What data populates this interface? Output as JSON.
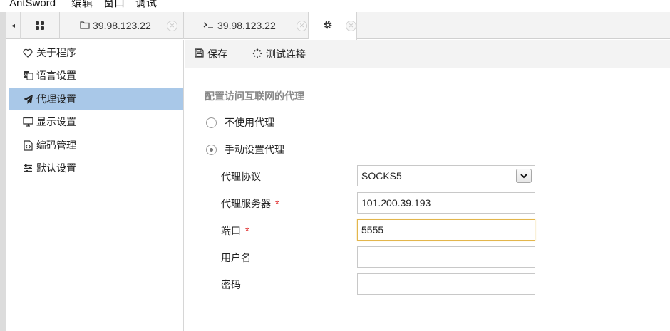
{
  "menubar": {
    "items": [
      "AntSword",
      "编辑",
      "窗口",
      "调试"
    ]
  },
  "tabs": {
    "scroll_left": "◂",
    "home_icon": "grid-icon",
    "items": [
      {
        "label": "39.98.123.22",
        "icon": "folder-icon",
        "close": "✕"
      },
      {
        "label": "39.98.123.22",
        "icon": "terminal-icon",
        "close": "✕"
      },
      {
        "label": "",
        "icon": "gear-icon",
        "close": "✕"
      }
    ]
  },
  "sidebar": {
    "items": [
      {
        "label": "关于程序",
        "icon": "heart-icon"
      },
      {
        "label": "语言设置",
        "icon": "language-icon"
      },
      {
        "label": "代理设置",
        "icon": "paper-plane-icon",
        "active": true
      },
      {
        "label": "显示设置",
        "icon": "monitor-icon"
      },
      {
        "label": "编码管理",
        "icon": "code-file-icon"
      },
      {
        "label": "默认设置",
        "icon": "sliders-icon"
      }
    ]
  },
  "toolbar": {
    "save_label": "保存",
    "test_label": "测试连接"
  },
  "form": {
    "title": "配置访问互联网的代理",
    "no_proxy_label": "不使用代理",
    "manual_proxy_label": "手动设置代理",
    "selected_mode": "manual",
    "protocol_label": "代理协议",
    "protocol_value": "SOCKS5",
    "server_label": "代理服务器",
    "server_value": "101.200.39.193",
    "port_label": "端口",
    "port_value": "5555",
    "username_label": "用户名",
    "username_value": "",
    "password_label": "密码",
    "password_value": "",
    "required_mark": "*"
  },
  "colors": {
    "active_sidebar": "#a9c8e8",
    "required": "#e02b2b",
    "focus_border": "#e3b64c"
  }
}
